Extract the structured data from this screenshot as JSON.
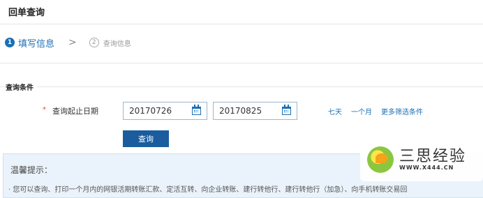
{
  "page": {
    "title": "回单查询"
  },
  "steps": [
    {
      "num": "1",
      "label": "填写信息"
    },
    {
      "num": "2",
      "label": "查询信息"
    }
  ],
  "steps_separator": ">",
  "section": {
    "title": "查询条件"
  },
  "date_range": {
    "required_mark": "*",
    "label": "查询起止日期",
    "start": "20170726",
    "end": "20170825"
  },
  "quick_links": [
    "七天",
    "一个月",
    "更多筛选条件"
  ],
  "query_button": "查询",
  "tips": {
    "title": "温馨提示：",
    "text": "· 您可以查询、打印一个月内的网银活期转账汇款、定活互转、向企业转账、建行转他行、建行转他行（加急）、向手机转账交易回"
  },
  "watermark": {
    "text": "三思经验",
    "url": "WWW.X444.CN"
  },
  "colors": {
    "accent": "#1a6fb5",
    "button": "#1a5c9e",
    "required": "#e04b2c",
    "tips_bg": "#eaf3fb"
  },
  "icons": {
    "calendar": "calendar-icon"
  }
}
